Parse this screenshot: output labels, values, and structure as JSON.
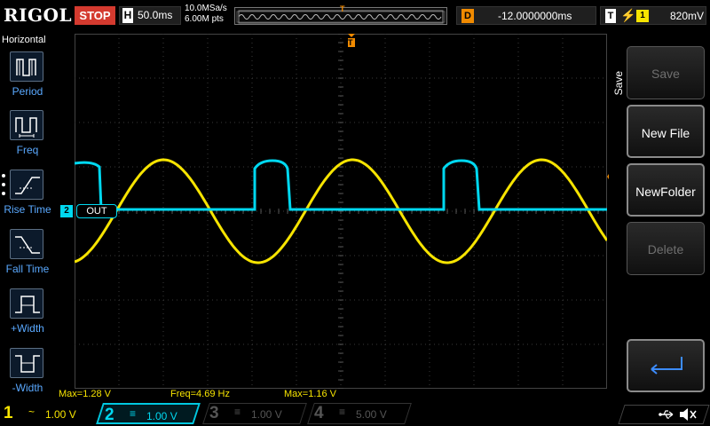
{
  "top": {
    "logo": "RIGOL",
    "run_state": "STOP",
    "timebase_label": "H",
    "timebase": "50.0ms",
    "sample_rate": "10.0MSa/s",
    "memory_depth": "6.00M pts",
    "trigger_pos_marker": "T",
    "delay_label": "D",
    "delay": "-12.0000000ms",
    "trigger_label": "T",
    "trigger_source": "1",
    "trigger_level": "820mV"
  },
  "left_menu": {
    "title": "Horizontal",
    "items": [
      {
        "label": "Period",
        "icon": "period-icon"
      },
      {
        "label": "Freq",
        "icon": "freq-icon"
      },
      {
        "label": "Rise Time",
        "icon": "rise-time-icon"
      },
      {
        "label": "Fall Time",
        "icon": "fall-time-icon"
      },
      {
        "label": "+Width",
        "icon": "pos-width-icon"
      },
      {
        "label": "-Width",
        "icon": "neg-width-icon"
      }
    ]
  },
  "right_menu": {
    "title": "Save",
    "buttons": [
      {
        "label": "Save",
        "enabled": false
      },
      {
        "label": "New File",
        "enabled": true
      },
      {
        "label": "NewFolder",
        "enabled": true
      },
      {
        "label": "Delete",
        "enabled": false
      }
    ],
    "return_icon": "return-arrow-icon"
  },
  "screen": {
    "ch2_label_marker": "2",
    "ch2_label": "OUT",
    "trigger_marker": "T"
  },
  "measurements": [
    {
      "text": "Max=1.28 V"
    },
    {
      "text": "Freq=4.69 Hz"
    },
    {
      "text": "Max=1.16 V"
    }
  ],
  "channels": [
    {
      "num": "1",
      "coupling": "~",
      "scale": "1.00 V",
      "color": "#f7e400",
      "active": true
    },
    {
      "num": "2",
      "coupling": "≡",
      "scale": "1.00 V",
      "color": "#00d8f0",
      "active": true
    },
    {
      "num": "3",
      "coupling": "≡",
      "scale": "1.00 V",
      "color": "#555555",
      "active": false
    },
    {
      "num": "4",
      "coupling": "≡",
      "scale": "5.00 V",
      "color": "#555555",
      "active": false
    }
  ],
  "status": {
    "icons": [
      "usb-icon",
      "speaker-muted-icon"
    ]
  },
  "colors": {
    "ch1": "#f7e400",
    "ch2": "#00d8f0",
    "trigger": "#f08a00",
    "stop": "#d43a2f",
    "grid": "#3a3a3a"
  }
}
